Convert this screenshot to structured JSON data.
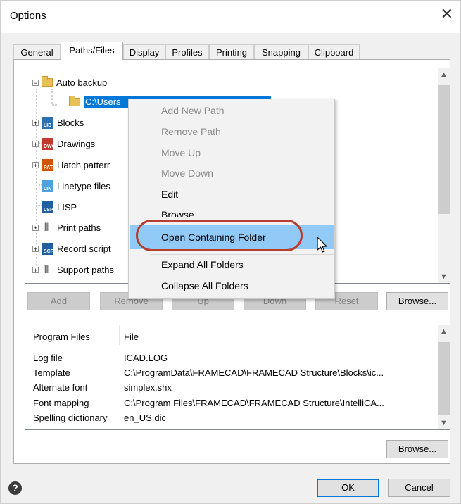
{
  "window": {
    "title": "Options",
    "close_glyph": "✕"
  },
  "tabs": [
    {
      "label": "General"
    },
    {
      "label": "Paths/Files"
    },
    {
      "label": "Display"
    },
    {
      "label": "Profiles"
    },
    {
      "label": "Printing"
    },
    {
      "label": "Snapping"
    },
    {
      "label": "Clipboard"
    }
  ],
  "active_tab": "Paths/Files",
  "tree": {
    "items": [
      {
        "label": "Auto backup",
        "expander": "−",
        "icon": "folder-icon"
      },
      {
        "label": "C:\\Users",
        "icon": "folder-icon",
        "selected": true
      },
      {
        "label": "Blocks",
        "expander": "+",
        "icon": "blocks-path-icon",
        "badge": "LIB"
      },
      {
        "label": "Drawings",
        "expander": "+",
        "icon": "drawings-path-icon",
        "badge": "DWG"
      },
      {
        "label": "Hatch patterr",
        "expander": "+",
        "icon": "hatch-path-icon",
        "badge": "PAT"
      },
      {
        "label": "Linetype files",
        "icon": "linetype-path-icon",
        "badge": "LIN"
      },
      {
        "label": "LISP",
        "icon": "lisp-path-icon",
        "badge": "LSP"
      },
      {
        "label": "Print paths",
        "expander": "+",
        "icon": "paperclip-icon"
      },
      {
        "label": "Record script",
        "expander": "+",
        "icon": "script-path-icon",
        "badge": "SCR"
      },
      {
        "label": "Support paths",
        "expander": "+",
        "icon": "paperclip-icon"
      }
    ]
  },
  "path_buttons": {
    "add": "Add",
    "remove": "Remove",
    "up": "Up",
    "down": "Down",
    "reset": "Reset",
    "browse": "Browse..."
  },
  "file_list": {
    "headers": [
      "Program Files",
      "File"
    ],
    "rows": [
      {
        "name": "Log file",
        "value": "ICAD.LOG"
      },
      {
        "name": "Template",
        "value": "C:\\ProgramData\\FRAMECAD\\FRAMECAD Structure\\Blocks\\ic..."
      },
      {
        "name": "Alternate font",
        "value": "simplex.shx"
      },
      {
        "name": "Font mapping",
        "value": "C:\\Program Files\\FRAMECAD\\FRAMECAD Structure\\IntelliCA..."
      },
      {
        "name": "Spelling dictionary",
        "value": "en_US.dic"
      }
    ],
    "browse": "Browse..."
  },
  "footer": {
    "help_glyph": "?",
    "ok": "OK",
    "cancel": "Cancel"
  },
  "context_menu": {
    "items": [
      {
        "label": "Add New Path",
        "enabled": false
      },
      {
        "label": "Remove Path",
        "enabled": false
      },
      {
        "label": "Move Up",
        "enabled": false
      },
      {
        "label": "Move Down",
        "enabled": false
      },
      {
        "label": "Edit",
        "enabled": true
      },
      {
        "label": "Browse",
        "enabled": true
      },
      {
        "label": "Open Containing Folder",
        "enabled": true,
        "highlighted": true
      },
      {
        "label": "Expand All Folders",
        "enabled": true
      },
      {
        "label": "Collapse All Folders",
        "enabled": true
      }
    ]
  },
  "colors": {
    "selection": "#0078d7",
    "menu_highlight": "#91c9f7",
    "annotation_oval": "#b83e2f"
  }
}
